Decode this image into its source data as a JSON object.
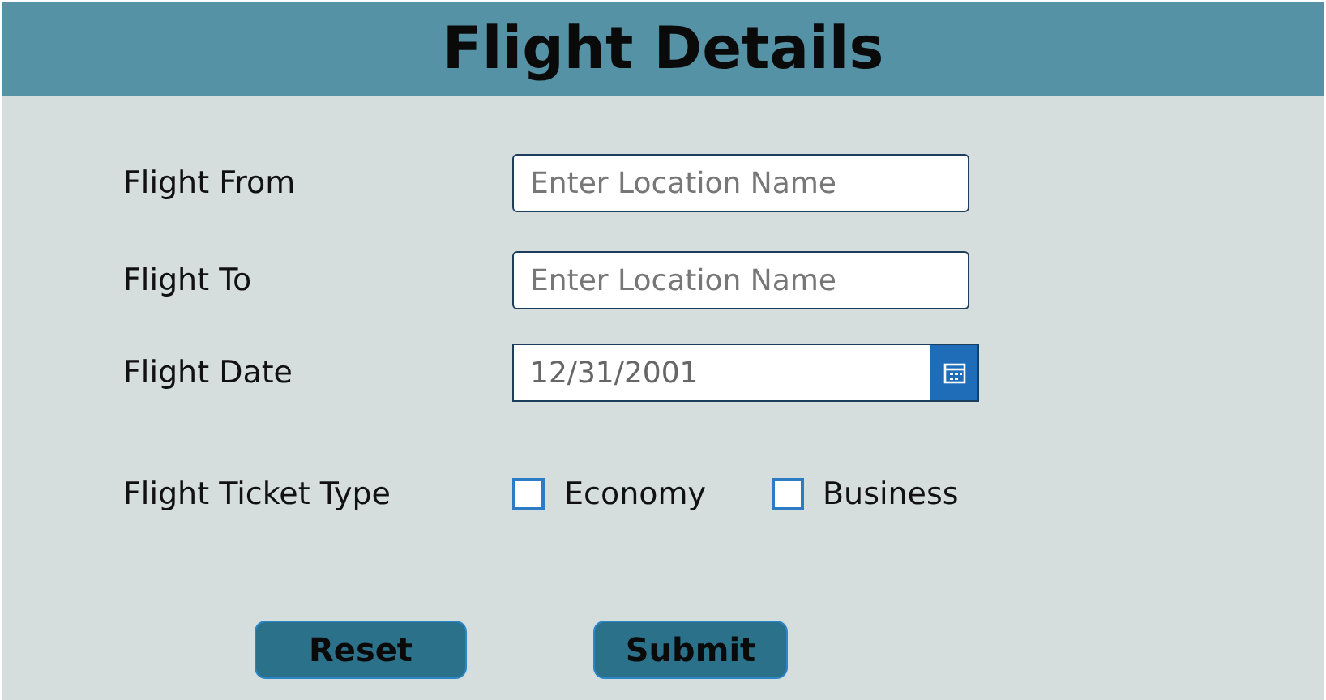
{
  "header": {
    "title": "Flight Details"
  },
  "fields": [
    {
      "kind": "text",
      "label": "Flight From",
      "placeholder": "Enter Location Name"
    },
    {
      "kind": "text",
      "label": "Flight To",
      "placeholder": "Enter Location Name"
    },
    {
      "kind": "date",
      "label": "Flight Date",
      "value": "12/31/2001"
    }
  ],
  "ticket_type": {
    "label": "Flight Ticket Type",
    "options": [
      {
        "label": "Economy",
        "checked": false
      },
      {
        "label": "Business",
        "checked": false
      }
    ]
  },
  "buttons": [
    "Reset",
    "Submit"
  ]
}
